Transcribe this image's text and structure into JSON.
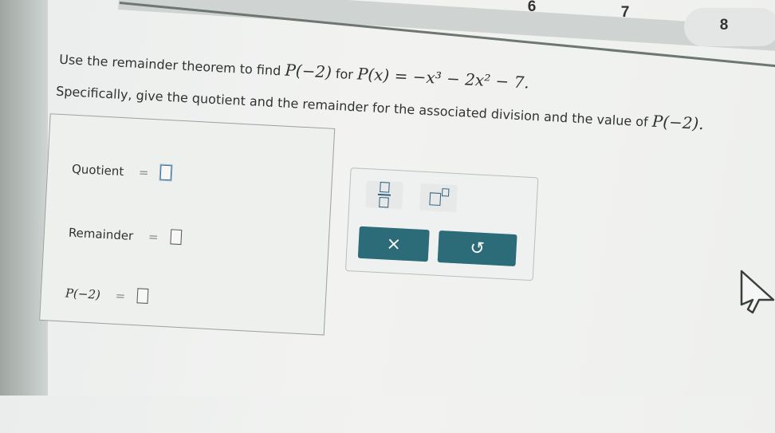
{
  "tabs": [
    "6",
    "7",
    "8"
  ],
  "question": {
    "line1_text": "Use the remainder theorem to find",
    "line1_point": "P(−2)",
    "line1_for": "for",
    "line1_poly": "P(x) = −x³ − 2x² − 7.",
    "line2_text": "Specifically, give the quotient and the remainder for the associated division and the value of",
    "line2_point": "P(−2)."
  },
  "answers": {
    "quotient_label": "Quotient",
    "remainder_label": "Remainder",
    "p_label": "P(−2)",
    "equals": "="
  },
  "toolbar": {
    "clear_symbol": "×",
    "undo_symbol": "↺"
  },
  "colors": {
    "button": "#2c6b78",
    "icon_blue": "#315f80"
  }
}
